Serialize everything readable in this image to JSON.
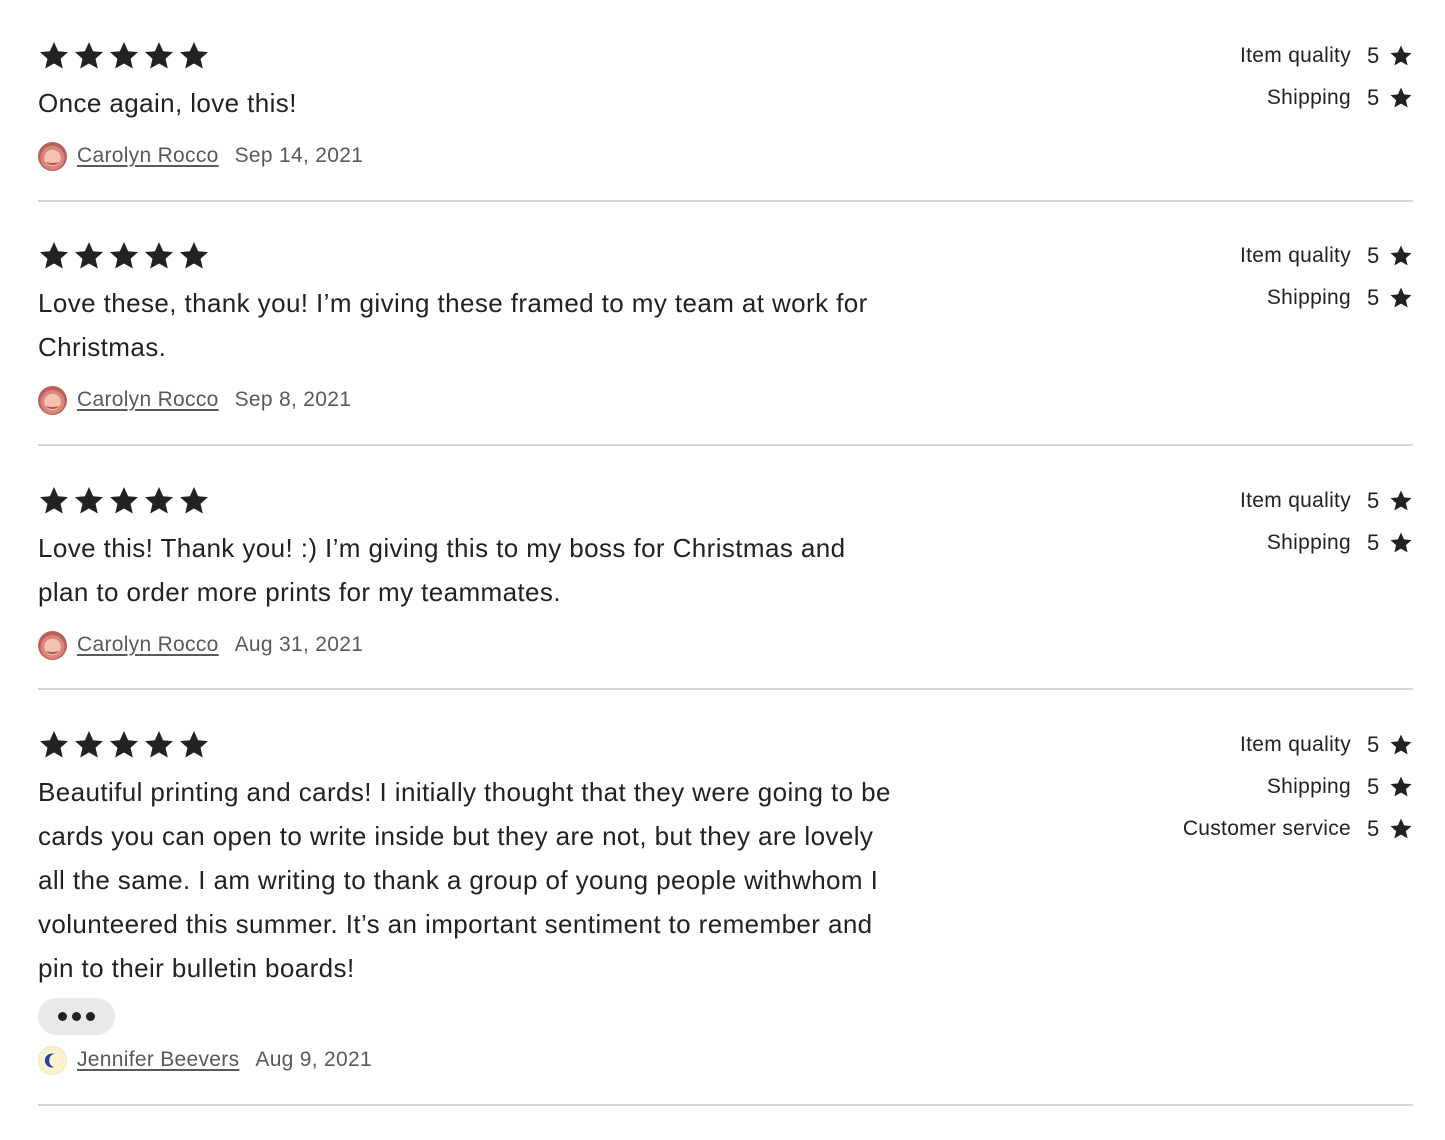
{
  "colors": {
    "text": "#222222",
    "muted": "#595959",
    "divider": "#d6d6d6",
    "more_button_bg": "#e9e9e9"
  },
  "reviews": [
    {
      "stars": 5,
      "text": "Once again, love this!",
      "author": "Carolyn Rocco",
      "date": "Sep 14, 2021",
      "avatar": "face-avatar",
      "ratings": [
        {
          "label": "Item quality",
          "value": "5"
        },
        {
          "label": "Shipping",
          "value": "5"
        }
      ]
    },
    {
      "stars": 5,
      "text": "Love these, thank you! I’m giving these framed to my team at work for Christmas.",
      "author": "Carolyn Rocco",
      "date": "Sep 8, 2021",
      "avatar": "face-avatar",
      "ratings": [
        {
          "label": "Item quality",
          "value": "5"
        },
        {
          "label": "Shipping",
          "value": "5"
        }
      ]
    },
    {
      "stars": 5,
      "text": "Love this! Thank you! :) I’m giving this to my boss for Christmas and plan to order more prints for my teammates.",
      "author": "Carolyn Rocco",
      "date": "Aug 31, 2021",
      "avatar": "face-avatar",
      "ratings": [
        {
          "label": "Item quality",
          "value": "5"
        },
        {
          "label": "Shipping",
          "value": "5"
        }
      ]
    },
    {
      "stars": 5,
      "text": "Beautiful printing and cards! I initially thought that they were going to be cards you can open to write inside but they are not, but they are lovely all the same. I am writing to thank a group of young people withwhom I volunteered this summer. It’s an important sentiment to remember and pin to their bulletin boards!",
      "author": "Jennifer Beevers",
      "date": "Aug 9, 2021",
      "avatar": "moon-avatar",
      "more_icon": "ellipsis-icon",
      "ratings": [
        {
          "label": "Item quality",
          "value": "5"
        },
        {
          "label": "Shipping",
          "value": "5"
        },
        {
          "label": "Customer service",
          "value": "5"
        }
      ]
    }
  ]
}
